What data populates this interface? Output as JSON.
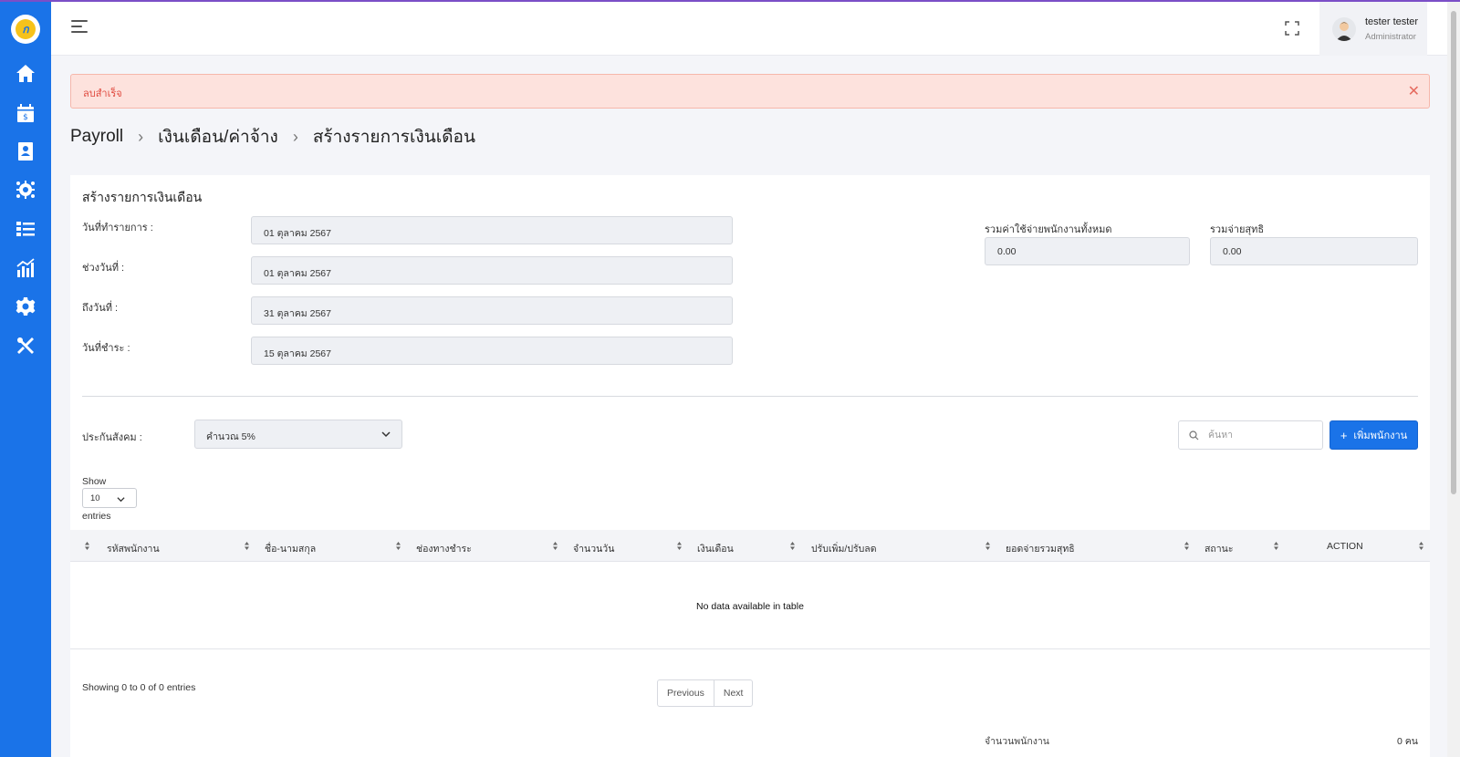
{
  "sidebar": {
    "logo_text": "ก",
    "items": [
      "home-icon",
      "salary-calendar-icon",
      "contacts-icon",
      "team-gear-icon",
      "list-icon",
      "chart-icon",
      "settings-icon",
      "tools-icon"
    ]
  },
  "header": {
    "user_name": "tester tester",
    "user_role": "Administrator"
  },
  "alert": {
    "message": "ลบสำเร็จ",
    "close": "✕"
  },
  "breadcrumb": [
    "Payroll",
    "เงินเดือน/ค่าจ้าง",
    "สร้างรายการเงินเดือน"
  ],
  "breadcrumb_sep": "›",
  "form": {
    "title": "สร้างรายการเงินเดือน",
    "transaction_date_label": "วันที่ทำรายการ :",
    "transaction_date": "01 ตุลาคม 2567",
    "period_start_label": "ช่วงวันที่ :",
    "period_start": "01 ตุลาคม 2567",
    "period_end_label": "ถึงวันที่ :",
    "period_end": "31 ตุลาคม 2567",
    "pay_date_label": "วันที่ชำระ :",
    "pay_date": "15 ตุลาคม 2567",
    "total_expense_label": "รวมค่าใช้จ่ายพนักงานทั้งหมด",
    "total_expense": "0.00",
    "total_net_label": "รวมจ่ายสุทธิ",
    "total_net": "0.00",
    "social_security_label": "ประกันสังคม :",
    "social_security_value": "คำนวณ 5%"
  },
  "toolbar": {
    "search_placeholder": "ค้นหา",
    "add_plus": "+",
    "add_label": "เพิ่มพนักงาน"
  },
  "table": {
    "show_label": "Show",
    "page_size": "10",
    "entries_label": "entries",
    "columns": [
      "รหัสพนักงาน",
      "ชื่อ-นามสกุล",
      "ช่องทางชำระ",
      "จำนวนวัน",
      "เงินเดือน",
      "ปรับเพิ่ม/ปรับลด",
      "ยอดจ่ายรวมสุทธิ",
      "สถานะ",
      "ACTION"
    ],
    "empty_message": "No data available in table",
    "info": "Showing 0 to 0 of 0 entries",
    "prev": "Previous",
    "next": "Next"
  },
  "summary": {
    "employee_count_label": "จำนวนพนักงาน",
    "employee_count": "0 คน"
  },
  "colors": {
    "primary": "#1a73e8",
    "alert_bg": "#fde2dd",
    "alert_text": "#e04a3f"
  }
}
